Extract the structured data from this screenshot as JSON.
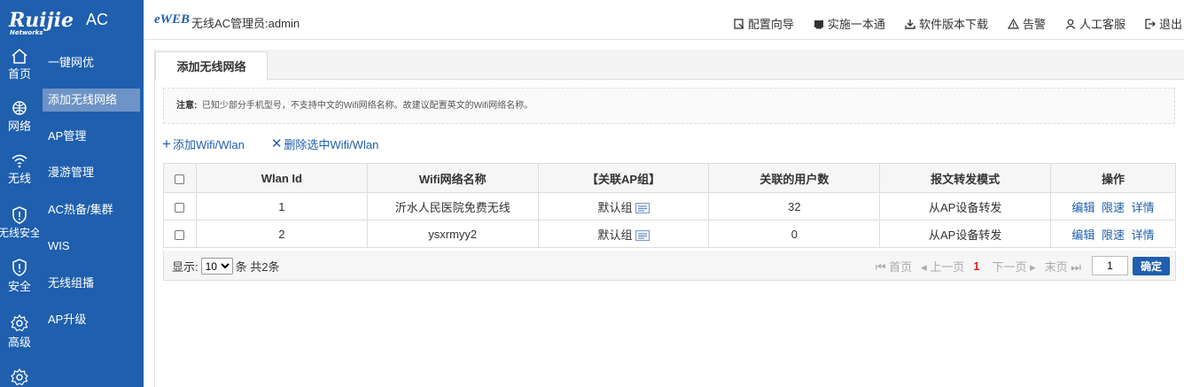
{
  "brand": {
    "logo": "Ruijie",
    "logo_sub": "Networks",
    "product": "AC"
  },
  "header": {
    "eweb": "eWEB",
    "admin": "无线AC管理员:admin",
    "nav": [
      {
        "label": "配置向导",
        "icon": "wizard-icon"
      },
      {
        "label": "实施一本通",
        "icon": "book-icon"
      },
      {
        "label": "软件版本下载",
        "icon": "download-icon"
      },
      {
        "label": "告警",
        "icon": "warning-icon"
      },
      {
        "label": "人工客服",
        "icon": "user-icon"
      },
      {
        "label": "退出",
        "icon": "logout-icon"
      }
    ]
  },
  "rail": [
    {
      "label": "首页",
      "icon": "home-icon"
    },
    {
      "label": "网络",
      "icon": "network-icon"
    },
    {
      "label": "无线",
      "icon": "wifi-icon"
    },
    {
      "label": "无线安全",
      "icon": "shield-icon"
    },
    {
      "label": "安全",
      "icon": "shield-icon"
    },
    {
      "label": "高级",
      "icon": "gear-icon"
    },
    {
      "label": "",
      "icon": "gear-icon"
    }
  ],
  "submenu": [
    "一键网优",
    "添加无线网络",
    "AP管理",
    "漫游管理",
    "AC热备/集群",
    "WIS",
    "无线组播",
    "AP升级"
  ],
  "tab": "添加无线网络",
  "notice": {
    "label": "注意:",
    "text": "已知少部分手机型号，不支持中文的Wifi网络名称。故建议配置英文的Wifi网络名称。"
  },
  "actions": {
    "add": "添加Wifi/Wlan",
    "delete": "删除选中Wifi/Wlan"
  },
  "table": {
    "headers": [
      "Wlan Id",
      "Wifi网络名称",
      "【关联AP组】",
      "关联的用户数",
      "报文转发模式",
      "操作"
    ],
    "rows": [
      {
        "id": "1",
        "name": "沂水人民医院免费无线",
        "group": "默认组",
        "users": "32",
        "mode": "从AP设备转发"
      },
      {
        "id": "2",
        "name": "ysxrmyy2",
        "group": "默认组",
        "users": "0",
        "mode": "从AP设备转发"
      }
    ],
    "ops": {
      "edit": "编辑",
      "limit": "限速",
      "detail": "详情"
    }
  },
  "pager": {
    "show": "显示:",
    "page_size": "10",
    "total": "条 共2条",
    "first": "首页",
    "prev": "上一页",
    "current": "1",
    "next": "下一页",
    "last": "末页",
    "input": "1",
    "confirm": "确定"
  },
  "colors": {
    "sidebar": "#1f5fae",
    "selected": "#6e93c6",
    "link": "#1f5fae",
    "page_current": "#e02020"
  }
}
